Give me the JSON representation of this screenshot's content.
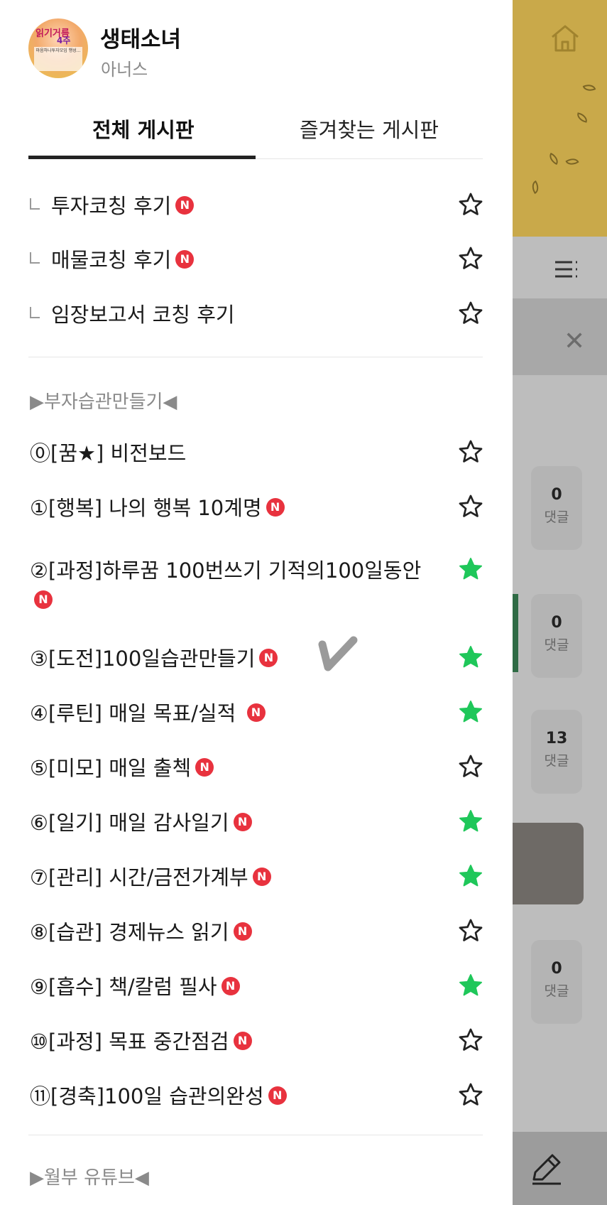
{
  "drawer": {
    "profile": {
      "cafe_name": "생태소녀",
      "member_grade": "아너스",
      "avatar_text_1": "읽기거름",
      "avatar_text_2": "4주",
      "avatar_text_3": "마음하나투자모임 행성..."
    },
    "tabs": [
      {
        "label": "전체 게시판",
        "active": true
      },
      {
        "label": "즐겨찾는 게시판",
        "active": false
      }
    ],
    "badge_label": "N",
    "coaching_boards": [
      {
        "label": "투자코칭 후기",
        "new": true,
        "favorite": false
      },
      {
        "label": "매물코칭 후기",
        "new": true,
        "favorite": false
      },
      {
        "label": "임장보고서 코칭 후기",
        "new": false,
        "favorite": false
      }
    ],
    "section_habits": "▶부자습관만들기◀",
    "habit_boards": [
      {
        "label": "⓪[꿈★] 비전보드",
        "new": false,
        "favorite": false
      },
      {
        "label": "①[행복] 나의 행복 10계명",
        "new": true,
        "favorite": false
      },
      {
        "label": "②[과정]하루꿈 100번쓰기 기적의100일동안",
        "new": true,
        "favorite": true
      },
      {
        "label": "③[도전]100일습관만들기",
        "new": true,
        "favorite": true
      },
      {
        "label": "④[루틴] 매일 목표/실적 ",
        "new": true,
        "favorite": true
      },
      {
        "label": "⑤[미모] 매일 출첵",
        "new": true,
        "favorite": false
      },
      {
        "label": "⑥[일기] 매일 감사일기",
        "new": true,
        "favorite": true
      },
      {
        "label": "⑦[관리] 시간/금전가계부",
        "new": true,
        "favorite": true
      },
      {
        "label": "⑧[습관] 경제뉴스 읽기",
        "new": true,
        "favorite": false
      },
      {
        "label": "⑨[흡수] 책/칼럼 필사",
        "new": true,
        "favorite": true
      },
      {
        "label": "⑩[과정] 목표 중간점검",
        "new": true,
        "favorite": false
      },
      {
        "label": "⑪[경축]100일 습관의완성",
        "new": true,
        "favorite": false
      }
    ],
    "section_youtube": "▶월부 유튜브◀"
  },
  "background": {
    "counts": [
      {
        "value": "0",
        "label": "댓글"
      },
      {
        "value": "0",
        "label": "댓글"
      },
      {
        "value": "13",
        "label": "댓글"
      },
      {
        "value": "0",
        "label": "댓글"
      }
    ]
  },
  "colors": {
    "badge_red": "#e8323e",
    "favorite_green": "#1fc75a",
    "banner_yellow": "#c9a94a"
  },
  "icons": [
    "home-icon",
    "menu-icon",
    "close-icon",
    "pencil-icon",
    "star-outline-icon",
    "star-filled-icon",
    "new-badge-icon"
  ]
}
